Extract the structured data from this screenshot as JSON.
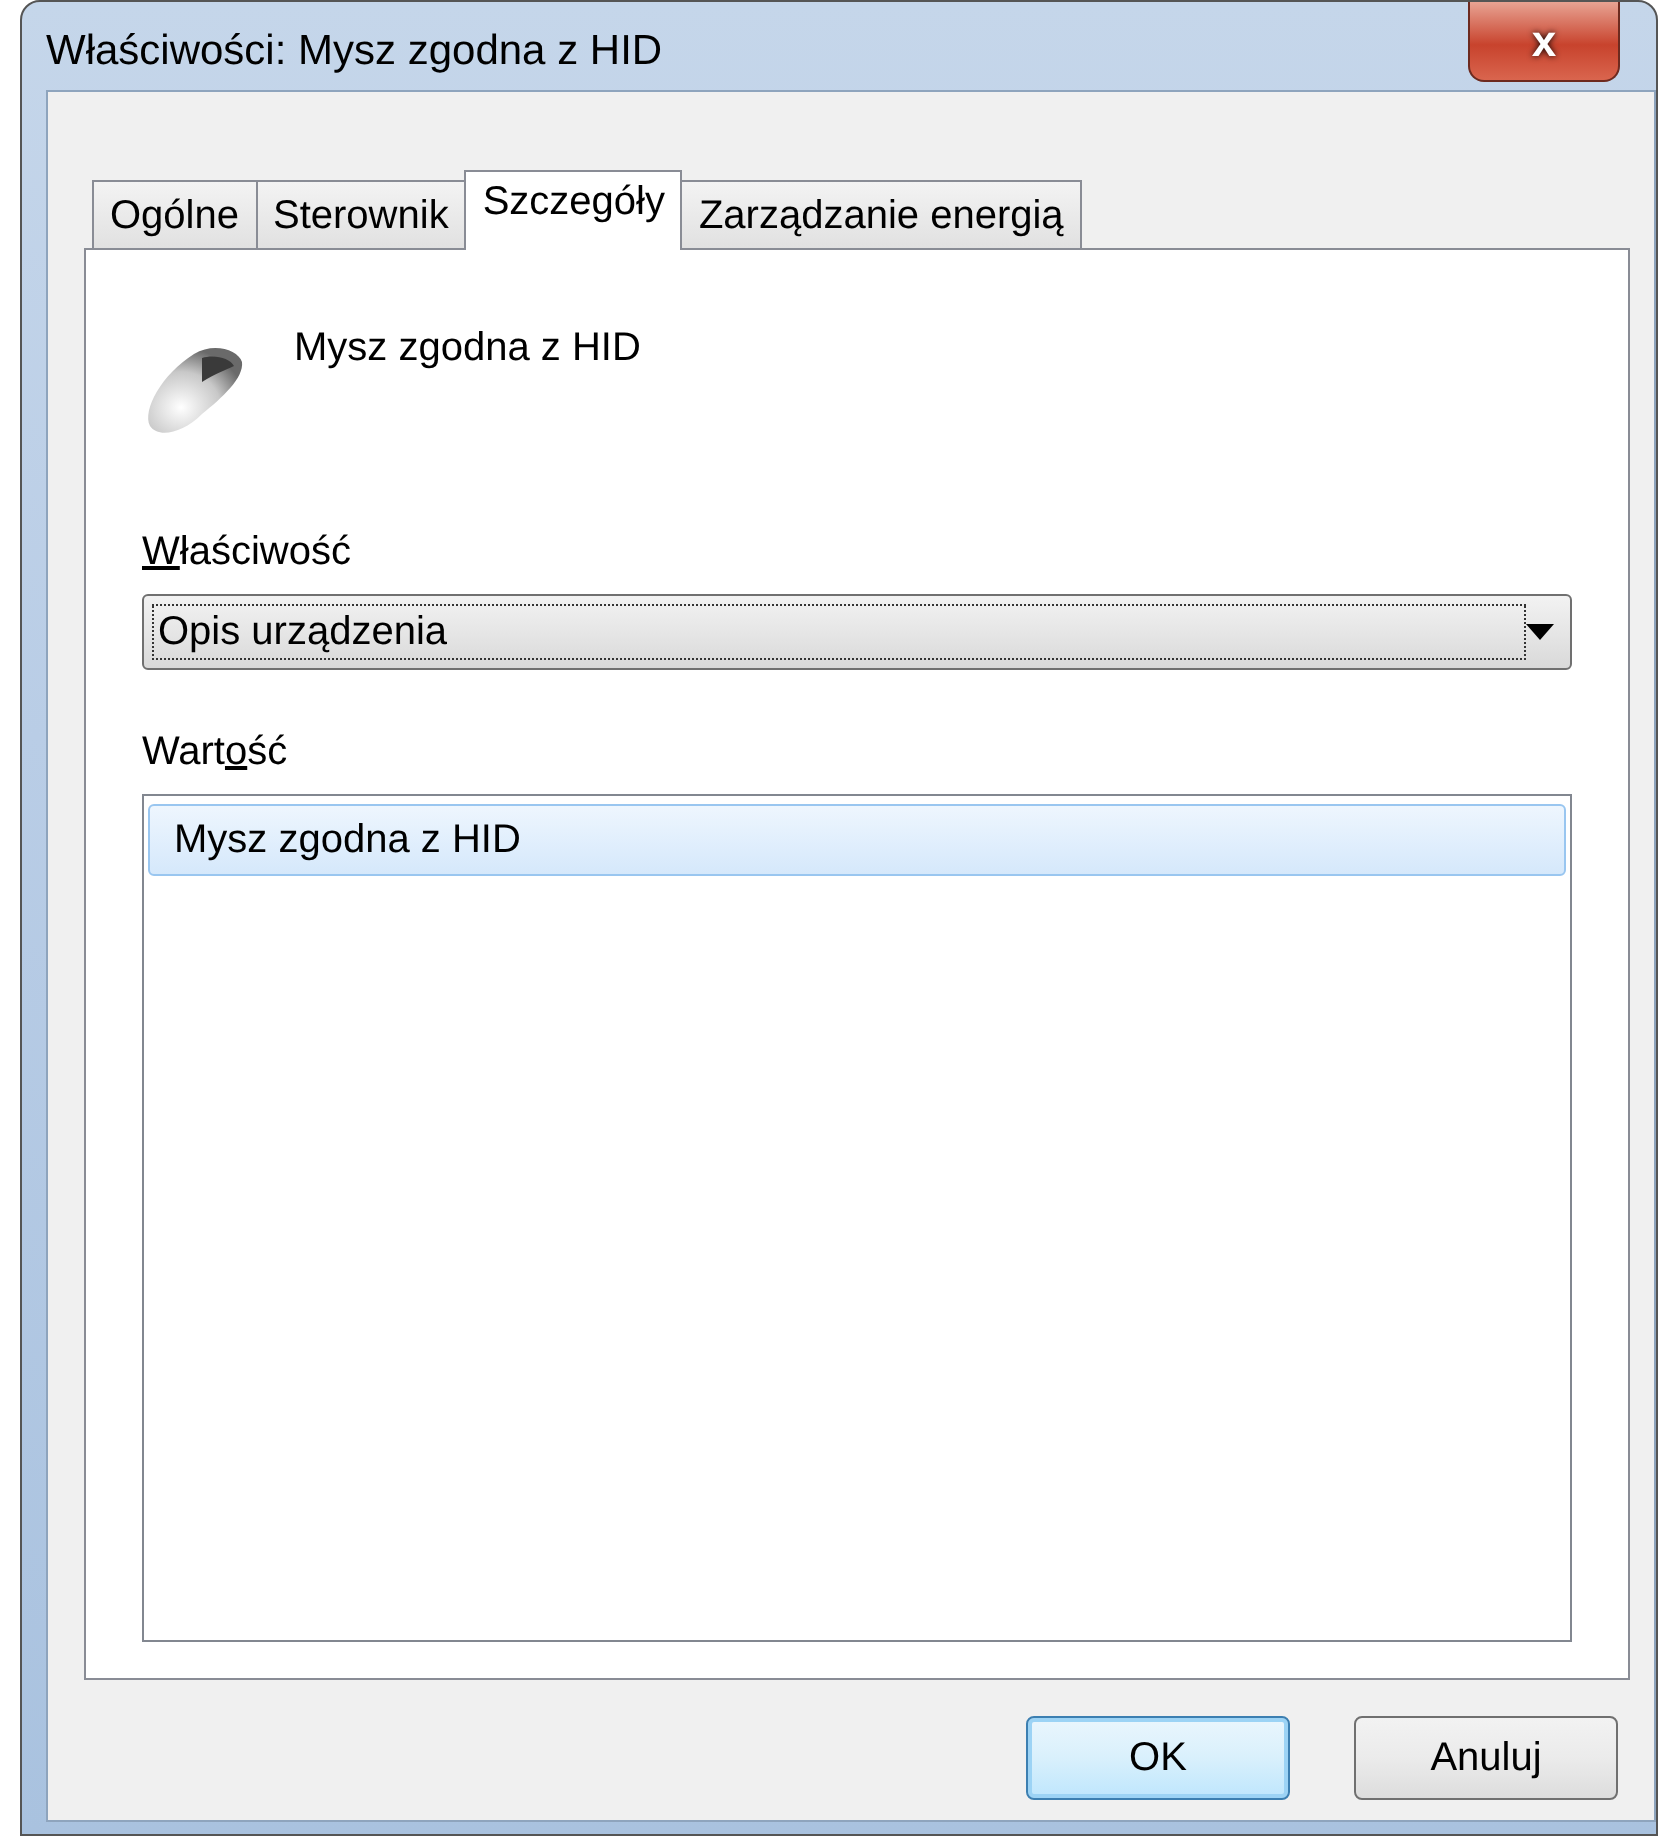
{
  "window": {
    "title": "Właściwości: Mysz zgodna z HID",
    "close": "x"
  },
  "tabs": [
    {
      "label": "Ogólne",
      "selected": false
    },
    {
      "label": "Sterownik",
      "selected": false
    },
    {
      "label": "Szczegóły",
      "selected": true
    },
    {
      "label": "Zarządzanie energią",
      "selected": false
    }
  ],
  "device": {
    "name": "Mysz zgodna z HID"
  },
  "property": {
    "label": {
      "key": "W",
      "after": "łaściwość"
    },
    "value": "Opis urządzenia"
  },
  "values": {
    "label": {
      "before": "Wart",
      "key": "o",
      "after": "ść"
    },
    "items": [
      {
        "text": "Mysz zgodna z HID",
        "selected": true
      }
    ]
  },
  "buttons": [
    {
      "label": "OK",
      "default": true
    },
    {
      "label": "Anuluj",
      "default": false
    }
  ]
}
